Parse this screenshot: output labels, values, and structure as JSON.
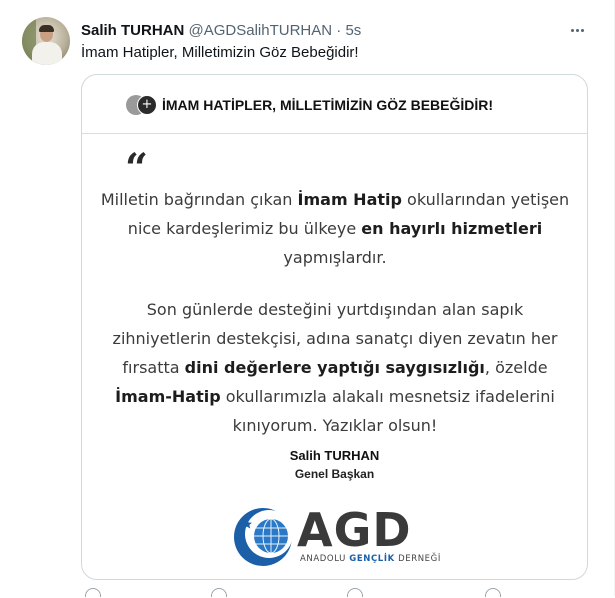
{
  "tweet": {
    "author_name": "Salih TURHAN",
    "author_handle": "@AGDSalihTURHAN",
    "separator": "·",
    "time": "5s",
    "text": "İmam Hatipler, Milletimizin Göz Bebeğidir!"
  },
  "card": {
    "badge_glyph": "+",
    "title": "İMAM HATİPLER, MİLLETİMİZİN GÖZ BEBEĞİDİR!",
    "quote_mark": "“",
    "paragraph1": [
      {
        "t": "Milletin bağrından çıkan ",
        "b": false
      },
      {
        "t": "İmam Hatip",
        "b": true
      },
      {
        "t": " okullarından yetişen nice kardeşlerimiz bu ülkeye ",
        "b": false
      },
      {
        "t": "en hayırlı hizmetleri",
        "b": true
      },
      {
        "t": " yapmışlardır.",
        "b": false
      }
    ],
    "paragraph2": [
      {
        "t": "Son günlerde desteğini yurtdışından alan sapık zihniyetlerin destekçisi, adına sanatçı diyen zevatın her fırsatta ",
        "b": false
      },
      {
        "t": "dini değerlere yaptığı saygısızlığı",
        "b": true
      },
      {
        "t": ", özelde ",
        "b": false
      },
      {
        "t": "İmam-Hatip",
        "b": true
      },
      {
        "t": " okullarımızla alakalı mesnetsiz ifadelerini kınıyorum. Yazıklar olsun!",
        "b": false
      }
    ],
    "signature_name": "Salih TURHAN",
    "signature_title": "Genel Başkan",
    "logo": {
      "wordmark": "AGD",
      "sub_part1": "ANADOLU ",
      "sub_highlight": "GENÇLİK",
      "sub_part2": " DERNEĞİ",
      "color_blue": "#1a5fa8",
      "color_gray": "#3a3a3a"
    }
  },
  "icons": {
    "more": "more-horizontal-icon",
    "badge": "plus-badge-icon"
  }
}
